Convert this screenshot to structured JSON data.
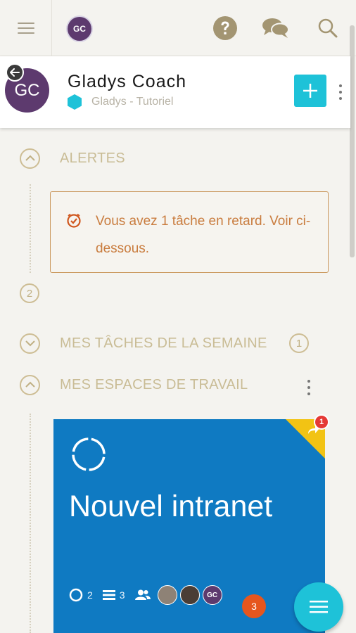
{
  "topbar": {
    "avatar_initials": "GC",
    "icons": [
      "menu-icon",
      "help-icon",
      "chat-icon",
      "search-icon"
    ]
  },
  "profile": {
    "avatar_initials": "GC",
    "name": "Gladys Coach",
    "subtitle": "Gladys - Tutoriel"
  },
  "sections": {
    "alerts": {
      "title": "ALERTES",
      "message": "Vous avez 1 tâche en retard. Voir ci-dessous."
    },
    "alerts_count": "2",
    "tasks": {
      "title": "MES TÂCHES DE LA SEMAINE",
      "count": "1"
    },
    "workspaces": {
      "title": "MES ESPACES DE TRAVAIL"
    }
  },
  "card": {
    "title": "Nouvel intranet",
    "notification_count": "1",
    "progress_count": "2",
    "list_count": "3",
    "members": [
      {
        "initials": ""
      },
      {
        "initials": ""
      },
      {
        "initials": "GC"
      }
    ],
    "badge_count": "3"
  },
  "colors": {
    "accent": "#1ec2d8",
    "card_blue": "#0f7ac2",
    "alert_orange": "#c97c3e",
    "avatar_purple": "#5d3a6e",
    "section_gold": "#c9bc95"
  }
}
